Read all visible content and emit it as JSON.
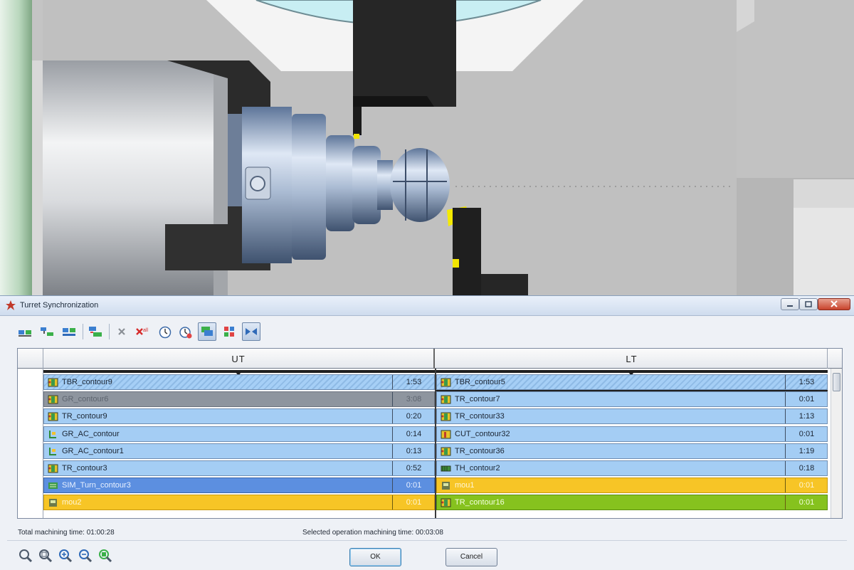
{
  "window": {
    "title": "Turret Synchronization"
  },
  "toolbar": {
    "buttons": [
      {
        "icon": "sync-turrets-icon"
      },
      {
        "icon": "align-operations-icon"
      },
      {
        "icon": "merge-rows-icon"
      },
      {
        "icon": "assign-turret-icon"
      },
      {
        "icon": "delete-icon"
      },
      {
        "icon": "delete-all-icon"
      },
      {
        "icon": "clock-icon"
      },
      {
        "icon": "clock-refresh-icon"
      },
      {
        "icon": "view-mode-icon",
        "pressed": true
      },
      {
        "icon": "color-legend-icon"
      },
      {
        "icon": "split-view-icon",
        "pressed": true
      }
    ]
  },
  "table": {
    "headers": {
      "ut": "UT",
      "lt": "LT"
    },
    "ut_rows": [
      {
        "name": "TBR_contour9",
        "time": "1:53",
        "style": "hatched",
        "icon": "turning-tool-icon"
      },
      {
        "name": "GR_contour6",
        "time": "3:08",
        "style": "grey",
        "icon": "turning-tool-icon"
      },
      {
        "name": "TR_contour9",
        "time": "0:20",
        "style": "normal",
        "icon": "turning-tool-icon"
      },
      {
        "name": "GR_AC_contour",
        "time": "0:14",
        "style": "normal",
        "icon": "grooving-tool-icon"
      },
      {
        "name": "GR_AC_contour1",
        "time": "0:13",
        "style": "normal",
        "icon": "grooving-tool-icon"
      },
      {
        "name": "TR_contour3",
        "time": "0:52",
        "style": "normal",
        "icon": "turning-tool-icon"
      },
      {
        "name": "SIM_Turn_contour3",
        "time": "0:01",
        "style": "selected",
        "icon": "sim-turn-icon"
      },
      {
        "name": "mou2",
        "time": "0:01",
        "style": "orange",
        "icon": "machine-op-icon"
      }
    ],
    "lt_rows": [
      {
        "name": "TBR_contour5",
        "time": "1:53",
        "style": "hatched",
        "icon": "turning-tool-icon"
      },
      {
        "name": "TR_contour7",
        "time": "0:01",
        "style": "normal",
        "icon": "turning-tool-icon"
      },
      {
        "name": "TR_contour33",
        "time": "1:13",
        "style": "normal",
        "icon": "turning-tool-icon"
      },
      {
        "name": "CUT_contour32",
        "time": "0:01",
        "style": "normal",
        "icon": "cutoff-tool-icon"
      },
      {
        "name": "TR_contour36",
        "time": "1:19",
        "style": "normal",
        "icon": "turning-tool-icon"
      },
      {
        "name": "TH_contour2",
        "time": "0:18",
        "style": "normal",
        "icon": "threading-tool-icon"
      },
      {
        "name": "mou1",
        "time": "0:01",
        "style": "orange",
        "icon": "machine-op-icon"
      },
      {
        "name": "TR_contour16",
        "time": "0:01",
        "style": "green",
        "icon": "turning-tool-icon"
      }
    ]
  },
  "status": {
    "total": "Total machining time: 01:00:28",
    "selected": "Selected operation machining time: 00:03:08"
  },
  "zoom_icons": [
    "zoom-icon",
    "zoom-window-icon",
    "zoom-in-icon",
    "zoom-out-icon",
    "zoom-fit-icon"
  ],
  "buttons": {
    "ok": "OK",
    "cancel": "Cancel"
  },
  "colors": {
    "row_blue": "#a4cdf4",
    "row_selected": "#5c8fe0",
    "row_orange": "#f7c526",
    "row_green": "#86c21e",
    "row_grey": "#8e959f"
  }
}
